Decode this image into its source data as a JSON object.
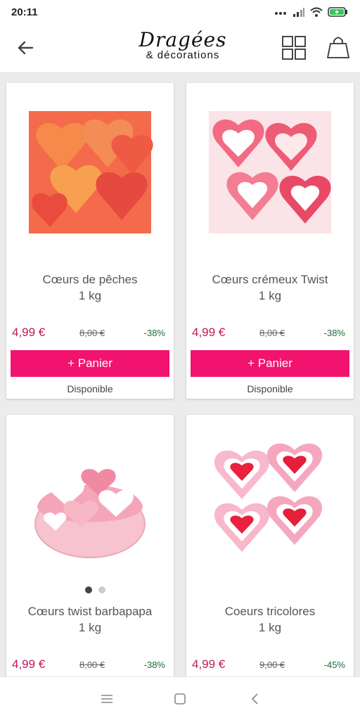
{
  "status": {
    "time": "20:11",
    "icons": [
      "signal-dots-icon",
      "cell-signal-icon",
      "wifi-icon",
      "battery-charging-icon"
    ]
  },
  "header": {
    "logo_line1": "Dragées",
    "logo_line2": "& décorations",
    "back_icon": "arrow-left-icon",
    "grid_icon": "grid-view-icon",
    "bag_icon": "shopping-bag-icon"
  },
  "colors": {
    "accent": "#f2136e",
    "price": "#c2185b",
    "discount": "#1e6b3a"
  },
  "products": [
    {
      "name": "Cœurs de pêches",
      "qty": "1 kg",
      "price": "4,99 €",
      "old_price": "8,00 €",
      "discount": "-38%",
      "cart_label": "+ Panier",
      "availability": "Disponible"
    },
    {
      "name": "Cœurs crémeux Twist",
      "qty": "1 kg",
      "price": "4,99 €",
      "old_price": "8,00 €",
      "discount": "-38%",
      "cart_label": "+ Panier",
      "availability": "Disponible"
    },
    {
      "name": "Cœurs twist barbapapa",
      "qty": "1 kg",
      "price": "4,99 €",
      "old_price": "8,00 €",
      "discount": "-38%",
      "image_slides": 2,
      "active_slide": 1
    },
    {
      "name": "Coeurs tricolores",
      "qty": "1 kg",
      "price": "4,99 €",
      "old_price": "9,00 €",
      "discount": "-45%"
    }
  ],
  "navbar": {
    "icons": [
      "menu-icon",
      "home-square-icon",
      "back-chevron-icon"
    ]
  }
}
